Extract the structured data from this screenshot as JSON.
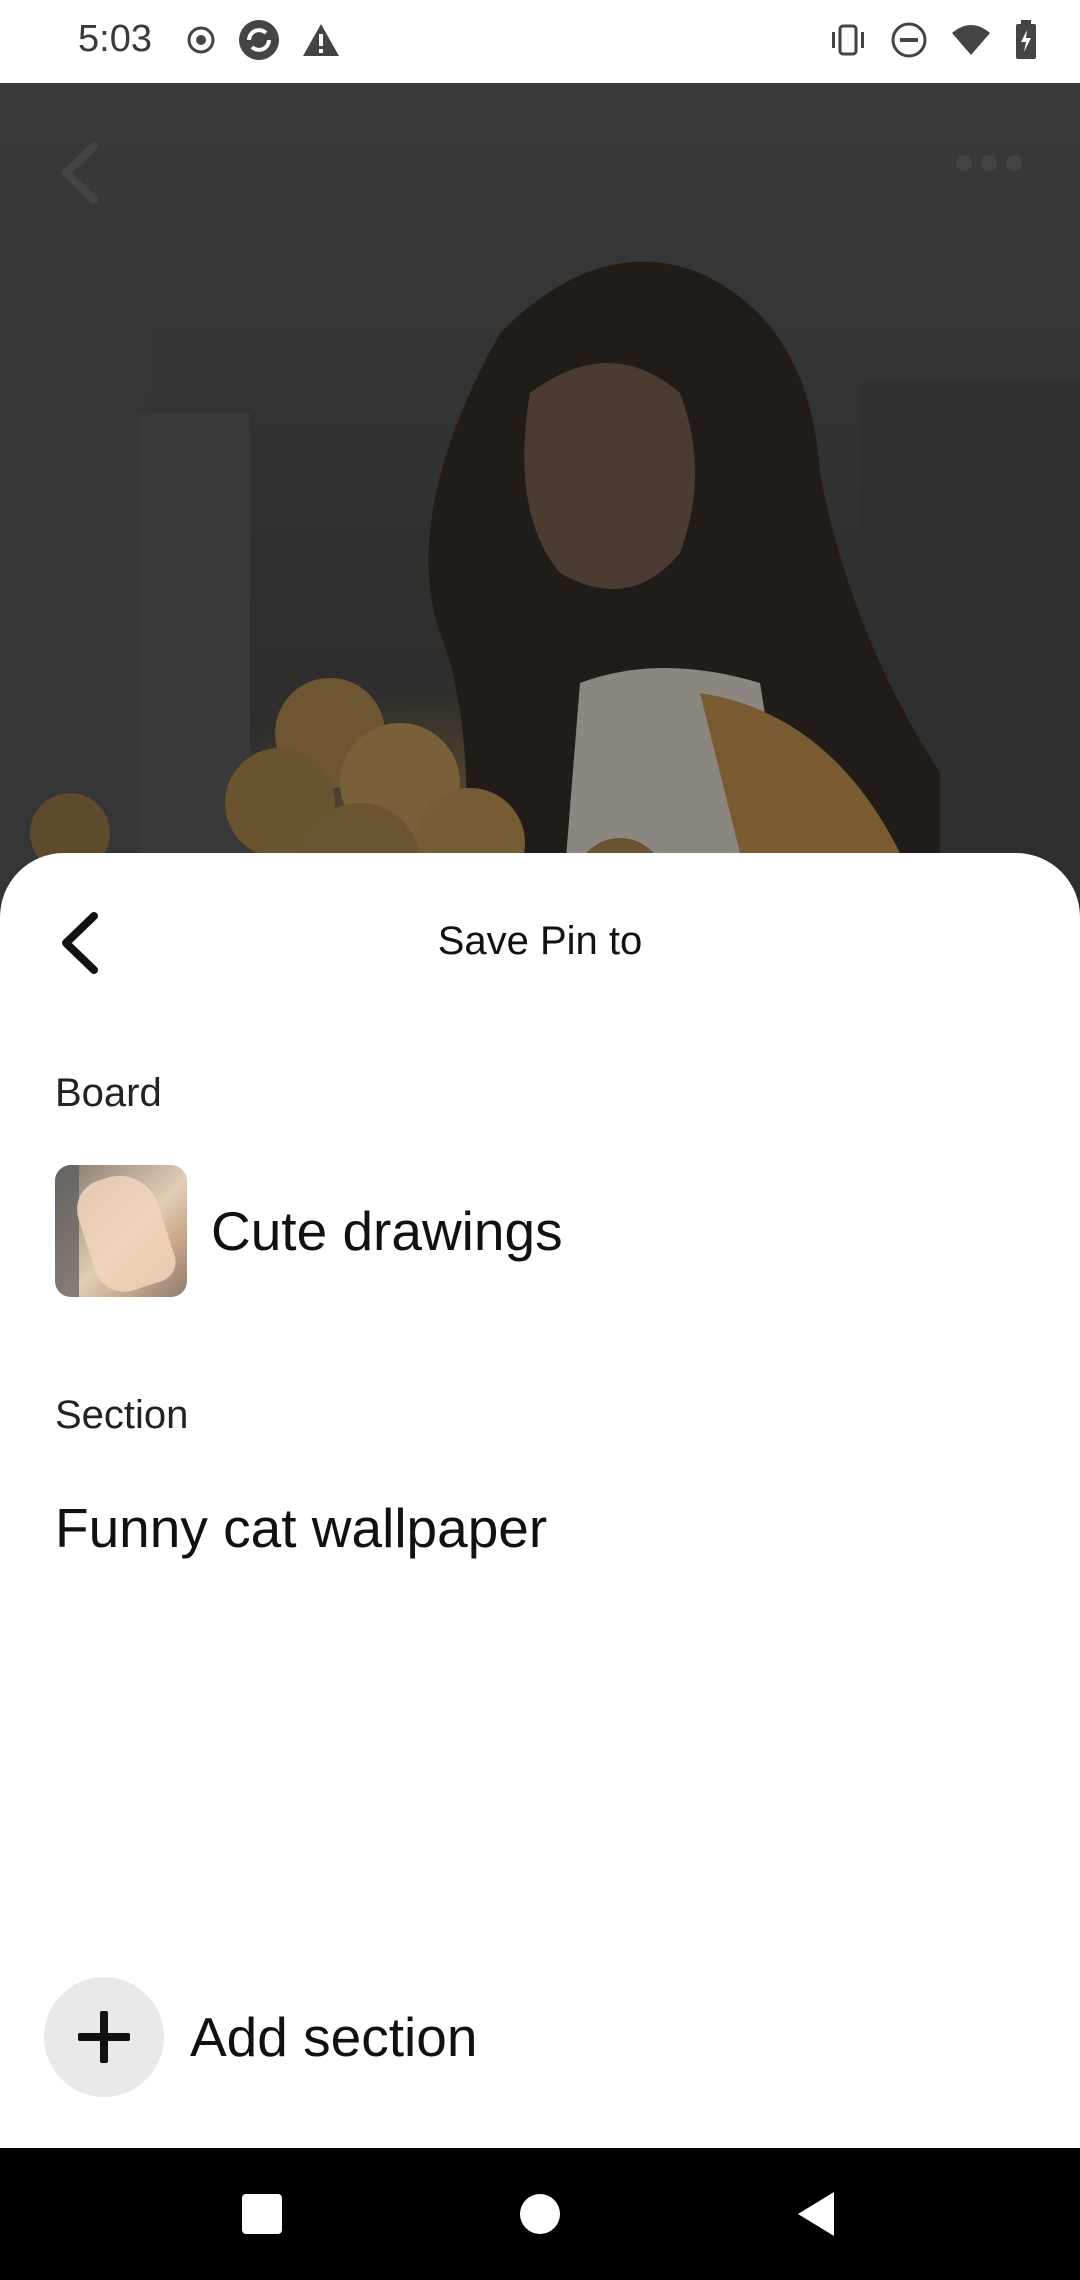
{
  "status_bar": {
    "time": "5:03",
    "left_icons": [
      "record-icon",
      "sync-icon",
      "warning-icon"
    ],
    "right_icons": [
      "vibrate-icon",
      "do-not-disturb-icon",
      "wifi-icon",
      "battery-icon"
    ]
  },
  "background": {
    "back_icon": "chevron-left-icon",
    "more_icon": "more-horizontal-icon"
  },
  "sheet": {
    "title": "Save Pin to",
    "board_label": "Board",
    "board_name": "Cute drawings",
    "section_label": "Section",
    "section_name": "Funny cat wallpaper",
    "add_section_label": "Add section"
  },
  "nav_bar": {
    "buttons": [
      "recents-button",
      "home-button",
      "back-button"
    ]
  },
  "colors": {
    "sheet_bg": "#ffffff",
    "text_primary": "#111111",
    "add_circle_bg": "#e9e9e9",
    "nav_bg": "#000000"
  }
}
